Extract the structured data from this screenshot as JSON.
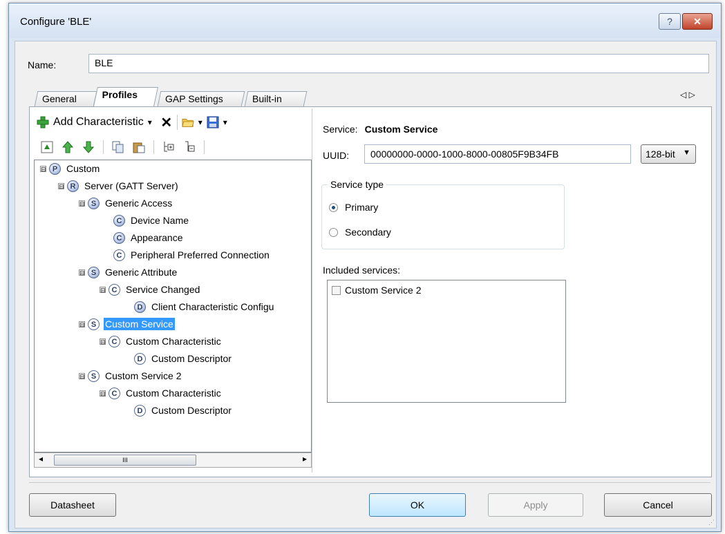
{
  "window": {
    "title": "Configure 'BLE'",
    "help_glyph": "?",
    "close_glyph": "✕"
  },
  "name_field": {
    "label": "Name:",
    "value": "BLE"
  },
  "tabs": [
    {
      "label": "General"
    },
    {
      "label": "Profiles"
    },
    {
      "label": "GAP Settings"
    },
    {
      "label": "Built-in"
    }
  ],
  "tab_scroll": "◁ ▷",
  "toolbar": {
    "add_label": "Add Characteristic",
    "dropdown_glyph": "▾",
    "delete_glyph": "✕"
  },
  "tree": [
    {
      "label": "Custom",
      "badge": "P",
      "expander": "⊟"
    },
    {
      "label": "Server (GATT Server)",
      "badge": "R",
      "expander": "⊟"
    },
    {
      "label": "Generic Access",
      "badge": "S",
      "expander": "⊟"
    },
    {
      "label": "Device Name",
      "badge": "C",
      "expander": ""
    },
    {
      "label": "Appearance",
      "badge": "C",
      "expander": ""
    },
    {
      "label": "Peripheral Preferred Connection",
      "badge": "C",
      "expander": ""
    },
    {
      "label": "Generic Attribute",
      "badge": "S",
      "expander": "⊟"
    },
    {
      "label": "Service Changed",
      "badge": "C",
      "expander": "⊟"
    },
    {
      "label": "Client Characteristic Configu",
      "badge": "D",
      "expander": ""
    },
    {
      "label": "Custom Service",
      "badge": "S",
      "expander": "⊟",
      "selected": true
    },
    {
      "label": "Custom Characteristic",
      "badge": "C",
      "expander": "⊟"
    },
    {
      "label": "Custom Descriptor",
      "badge": "D",
      "expander": ""
    },
    {
      "label": "Custom Service 2",
      "badge": "S",
      "expander": "⊟"
    },
    {
      "label": "Custom Characteristic",
      "badge": "C",
      "expander": "⊟"
    },
    {
      "label": "Custom Descriptor",
      "badge": "D",
      "expander": ""
    }
  ],
  "hscroll": {
    "left": "◂",
    "right": "▸",
    "thumb": "III"
  },
  "service": {
    "label": "Service:",
    "name": "Custom Service",
    "uuid_label": "UUID:",
    "uuid": "00000000-0000-1000-8000-00805F9B34FB",
    "uuid_size": "128-bit",
    "type_title": "Service type",
    "type_options": [
      {
        "label": "Primary",
        "checked": true
      },
      {
        "label": "Secondary",
        "checked": false
      }
    ],
    "included_label": "Included services:",
    "included": [
      {
        "label": "Custom Service 2",
        "checked": false
      }
    ]
  },
  "buttons": {
    "datasheet": "Datasheet",
    "ok": "OK",
    "apply": "Apply",
    "cancel": "Cancel"
  }
}
